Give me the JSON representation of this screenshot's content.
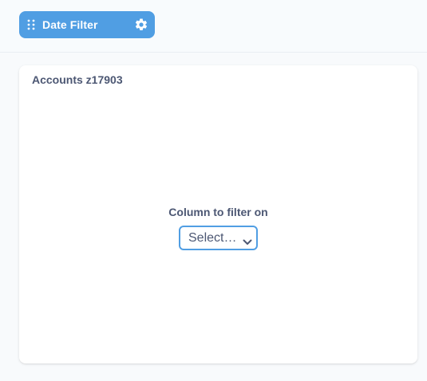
{
  "filter": {
    "label": "Date Filter",
    "chip_color": "#509EE3",
    "drag_icon": "drag-handle-icon",
    "settings_icon": "gear-icon"
  },
  "card": {
    "title": "Accounts z17903",
    "column_label": "Column to filter on",
    "select_value": "Select…",
    "select_icon": "chevron-down-icon"
  }
}
